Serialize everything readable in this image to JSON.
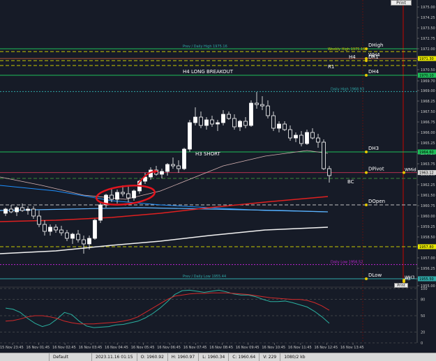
{
  "colors": {
    "background": "#161b27",
    "bull_candle": "#ffffff",
    "bear_candle": "#ffffff",
    "wick": "#ffffff",
    "annotation_circle": "#e1141e",
    "h_green": "#1fbf5a",
    "h_brown": "#b0553a",
    "h_yellow": "#c8c800",
    "h_magenta": "#c026d3",
    "h_teal": "#2fa8a8",
    "ma_red": "#e02020",
    "ma_white": "#f2f2f2",
    "ma_blue": "#1e90ff",
    "ma_lightblue": "#5fb6ff",
    "ma_pink": "#d8b4b4",
    "stoch_teal": "#2ab0a0",
    "stoch_red": "#d42a2a",
    "vertical_red": "#8b0d0d"
  },
  "buttons": {
    "print": "Print",
    "print2": "Print"
  },
  "levels": [
    {
      "id": "dhigh",
      "price": 1972.0,
      "label_left": "Prev / Daily High 1975.16",
      "label_right": "DHigh",
      "color": "#1fbf5a",
      "style": "solid",
      "left_label_color": "#2fa8a8",
      "right_label_color": "#ffffff"
    },
    {
      "id": "weekly-high",
      "price": 1971.8,
      "label_left": "Weekly High 1975.16",
      "label_right": "",
      "color": "#c8c800",
      "style": "dash",
      "left_label_color": "#c8c800"
    },
    {
      "id": "wh4",
      "price": 1971.3,
      "label_left": "",
      "label_right": "WH4",
      "color": "#b0553a",
      "style": "solid",
      "right_label_color": "#ffffff"
    },
    {
      "id": "dr1",
      "price": 1971.15,
      "label_left": "H4",
      "label_right": "DR1",
      "color": "#c8c800",
      "style": "dash",
      "right_label_color": "#ffffff"
    },
    {
      "id": "r1",
      "price": 1970.8,
      "label_left": "R1",
      "label_right": "",
      "color": "#c8c800",
      "style": "dash"
    },
    {
      "id": "dh4",
      "price": 1970.1,
      "label_left": "H4 LONG BREAKOUT",
      "label_right": "DH4",
      "color": "#1fbf5a",
      "style": "solid",
      "right_label_color": "#ffffff"
    },
    {
      "id": "daily-high",
      "price": 1968.93,
      "label_left": "Daily High 1968.93",
      "label_right": "",
      "color": "#2fa8a8",
      "style": "dot",
      "left_label_color": "#2fa8a8"
    },
    {
      "id": "dh3",
      "price": 1964.6,
      "label_left": "H3 SHORT",
      "label_right": "DH3",
      "color": "#1fbf5a",
      "style": "solid",
      "right_label_color": "#ffffff"
    },
    {
      "id": "dpivot",
      "price": 1963.12,
      "label_left": "",
      "label_right": "DPivot",
      "color": "#b03050",
      "style": "solid",
      "right_label_color": "#ffffff"
    },
    {
      "id": "bc",
      "price": 1962.7,
      "label_left": "BC",
      "label_right": "",
      "color": "#3a8a3a",
      "style": "dash"
    },
    {
      "id": "dopen",
      "price": 1960.8,
      "label_left": "",
      "label_right": "DOpen",
      "color": "#c0c0c0",
      "style": "dash",
      "right_label_color": "#ffffff"
    },
    {
      "id": "wmid",
      "price": 1957.8,
      "label_left": "",
      "label_right": "",
      "color": "#c8c800",
      "style": "dash"
    },
    {
      "id": "daily-low",
      "price": 1956.52,
      "label_left": "Daily Low 1956.52",
      "label_right": "",
      "color": "#c026d3",
      "style": "dot",
      "left_label_color": "#c026d3"
    },
    {
      "id": "dlow",
      "price": 1955.5,
      "label_left": "Prev / Daily Low 1955.44",
      "label_right": "DLow",
      "color": "#2fa8a8",
      "style": "solid",
      "left_label_color": "#2fa8a8",
      "right_label_color": "#ffffff"
    }
  ],
  "right_marker_labels": [
    {
      "text": "WMid",
      "price": 1963.12
    },
    {
      "text": "WH3",
      "price": 1955.4
    },
    {
      "text": "H3",
      "price": 1955.3
    }
  ],
  "price_axis": {
    "min": 1955.0,
    "max": 1975.5,
    "ticks": [
      "1975.00",
      "1974.25",
      "1973.50",
      "1972.75",
      "1972.00",
      "1971.25",
      "1970.50",
      "1969.70",
      "1969.00",
      "1968.25",
      "1967.50",
      "1966.75",
      "1966.00",
      "1965.25",
      "1964.50",
      "1963.75",
      "1963.00",
      "1962.25",
      "1961.50",
      "1960.75",
      "1960.00",
      "1959.25",
      "1958.50",
      "1957.80",
      "1957.00",
      "1956.25",
      "1955.50",
      "1955.00"
    ],
    "highlight_labels": [
      {
        "text": "1971.30",
        "price": 1971.3,
        "bg": "#e6e600",
        "fg": "#000000"
      },
      {
        "text": "1970.10",
        "price": 1970.1,
        "bg": "#1fbf5a",
        "fg": "#000000"
      },
      {
        "text": "1964.60",
        "price": 1964.6,
        "bg": "#1fbf5a",
        "fg": "#000000"
      },
      {
        "text": "1963.12",
        "price": 1963.12,
        "bg": "#d8d8d8",
        "fg": "#000000"
      },
      {
        "text": "1957.80",
        "price": 1957.8,
        "bg": "#e6e600",
        "fg": "#000000"
      },
      {
        "text": "1955.50",
        "price": 1955.5,
        "bg": "#2fa8a8",
        "fg": "#000000"
      }
    ]
  },
  "time_axis": [
    "15 Nov 23:45",
    "16 Nov 01:45",
    "16 Nov 02:45",
    "16 Nov 03:45",
    "16 Nov 04:45",
    "16 Nov 05:45",
    "16 Nov 06:45",
    "16 Nov 07:45",
    "16 Nov 08:45",
    "16 Nov 09:45",
    "16 Nov 10:45",
    "16 Nov 11:45",
    "16 Nov 12:45",
    "16 Nov 13:45"
  ],
  "oscillator": {
    "levels": [
      "100",
      "80",
      "50",
      "20",
      "0"
    ],
    "teal": [
      64,
      62,
      56,
      45,
      36,
      30,
      34,
      44,
      56,
      52,
      40,
      31,
      28,
      29,
      30,
      33,
      34,
      37,
      40,
      46,
      54,
      64,
      76,
      89,
      96,
      97,
      95,
      93,
      95,
      97,
      94,
      90,
      88,
      88,
      85,
      80,
      76,
      76,
      77,
      74,
      70,
      66,
      58,
      48,
      36
    ],
    "red": [
      40,
      41,
      44,
      48,
      50,
      50,
      48,
      45,
      40,
      37,
      35,
      35,
      35,
      36,
      37,
      38,
      40,
      43,
      48,
      56,
      64,
      72,
      80,
      86,
      88,
      90,
      91,
      91,
      92,
      92,
      92,
      91,
      90,
      89,
      87,
      85,
      83,
      82,
      81,
      80,
      80,
      78,
      74,
      68,
      60
    ]
  },
  "candles": [
    [
      1960.2,
      1960.6,
      1960.0,
      1960.5
    ],
    [
      1960.5,
      1960.8,
      1960.2,
      1960.3
    ],
    [
      1960.3,
      1960.7,
      1960.0,
      1960.6
    ],
    [
      1960.6,
      1960.9,
      1960.3,
      1960.4
    ],
    [
      1960.4,
      1960.7,
      1960.1,
      1960.5
    ],
    [
      1960.5,
      1960.7,
      1959.8,
      1960.0
    ],
    [
      1960.0,
      1960.4,
      1959.2,
      1959.4
    ],
    [
      1959.4,
      1959.7,
      1958.6,
      1958.9
    ],
    [
      1958.9,
      1959.4,
      1958.6,
      1959.2
    ],
    [
      1959.2,
      1959.4,
      1958.8,
      1959.0
    ],
    [
      1959.0,
      1959.3,
      1958.6,
      1958.8
    ],
    [
      1958.8,
      1959.0,
      1958.2,
      1958.4
    ],
    [
      1958.4,
      1958.8,
      1958.0,
      1958.7
    ],
    [
      1958.7,
      1959.0,
      1958.1,
      1958.3
    ],
    [
      1958.3,
      1958.6,
      1957.3,
      1958.0
    ],
    [
      1958.0,
      1958.6,
      1957.6,
      1958.4
    ],
    [
      1958.4,
      1959.8,
      1958.3,
      1959.7
    ],
    [
      1959.7,
      1961.0,
      1959.5,
      1960.8
    ],
    [
      1960.8,
      1961.6,
      1960.6,
      1961.5
    ],
    [
      1961.5,
      1962.0,
      1961.0,
      1961.2
    ],
    [
      1961.2,
      1961.9,
      1960.9,
      1961.7
    ],
    [
      1961.7,
      1962.2,
      1961.4,
      1961.6
    ],
    [
      1961.6,
      1962.1,
      1961.0,
      1961.3
    ],
    [
      1961.3,
      1961.9,
      1961.1,
      1961.8
    ],
    [
      1961.8,
      1962.6,
      1961.6,
      1962.5
    ],
    [
      1962.5,
      1963.1,
      1962.3,
      1962.8
    ],
    [
      1962.8,
      1963.5,
      1962.6,
      1963.3
    ],
    [
      1963.3,
      1963.6,
      1962.9,
      1963.0
    ],
    [
      1963.0,
      1963.4,
      1962.7,
      1963.2
    ],
    [
      1963.2,
      1963.8,
      1962.9,
      1963.7
    ],
    [
      1963.7,
      1964.2,
      1963.4,
      1963.6
    ],
    [
      1963.6,
      1964.0,
      1963.1,
      1963.4
    ],
    [
      1963.4,
      1964.9,
      1963.3,
      1964.8
    ],
    [
      1964.8,
      1966.9,
      1964.6,
      1966.7
    ],
    [
      1966.7,
      1967.8,
      1966.5,
      1967.1
    ],
    [
      1967.1,
      1967.5,
      1966.3,
      1966.5
    ],
    [
      1966.5,
      1967.1,
      1966.2,
      1966.9
    ],
    [
      1966.9,
      1967.2,
      1966.4,
      1966.6
    ],
    [
      1966.6,
      1966.9,
      1966.1,
      1966.7
    ],
    [
      1966.7,
      1967.6,
      1966.5,
      1967.3
    ],
    [
      1967.3,
      1967.5,
      1966.9,
      1967.0
    ],
    [
      1967.0,
      1967.3,
      1966.2,
      1966.4
    ],
    [
      1966.4,
      1966.9,
      1966.1,
      1966.8
    ],
    [
      1966.8,
      1967.1,
      1966.3,
      1966.5
    ],
    [
      1966.5,
      1968.3,
      1966.4,
      1968.1
    ],
    [
      1968.1,
      1968.9,
      1967.7,
      1968.0
    ],
    [
      1968.0,
      1968.6,
      1967.6,
      1967.9
    ],
    [
      1967.9,
      1968.3,
      1967.0,
      1967.2
    ],
    [
      1967.2,
      1967.5,
      1966.1,
      1966.3
    ],
    [
      1966.3,
      1966.8,
      1966.0,
      1966.6
    ],
    [
      1966.6,
      1966.8,
      1966.1,
      1966.2
    ],
    [
      1966.2,
      1966.5,
      1965.4,
      1965.6
    ],
    [
      1965.6,
      1966.0,
      1965.3,
      1965.8
    ],
    [
      1965.8,
      1966.1,
      1965.0,
      1965.2
    ],
    [
      1965.2,
      1966.2,
      1965.1,
      1966.0
    ],
    [
      1966.0,
      1966.3,
      1965.5,
      1965.6
    ],
    [
      1965.6,
      1965.9,
      1964.9,
      1965.3
    ],
    [
      1965.3,
      1965.5,
      1963.3,
      1963.4
    ],
    [
      1963.4,
      1963.6,
      1962.4,
      1962.9
    ]
  ],
  "status_bar": {
    "profile": "Default",
    "datetime": "2023.11.16 01:15",
    "open": "O: 1960.92",
    "high": "H: 1960.97",
    "low": "L: 1960.34",
    "close": "C: 1960.64",
    "volume": "V: 229",
    "traffic": "1080/2 kb"
  }
}
